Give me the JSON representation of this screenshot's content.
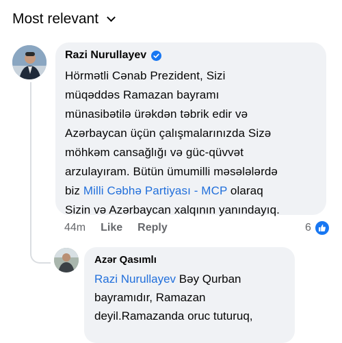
{
  "sort": {
    "label": "Most relevant",
    "icon": "chevron-down-icon"
  },
  "comments": [
    {
      "author": "Razi Nurullayev",
      "verified": true,
      "text_before": "Hörmətli Cənab Prezident, Sizi\nmüqəddəs Ramazan bayramı\nmünasibətilə ürəkdən təbrik edir və\nAzərbaycan üçün çalışmalarınızda Sizə\nmöhkəm cansağlığı və güc-qüvvət\narzulayıram. Bütün ümumilli məsələlərdə\nbiz ",
      "mention": "Milli Cəbhə Partiyası - MCP",
      "text_after": " olaraq\nSizin və Azərbaycan xalqının yanındayıq.",
      "time": "44m",
      "like_label": "Like",
      "reply_label": "Reply",
      "reaction_count": "6",
      "reaction_icon": "like-icon"
    }
  ],
  "replies": [
    {
      "author": "Azər Qasımlı",
      "mention": "Razi Nurullayev",
      "text": " Bəy Qurban\nbayramıdır, Ramazan\ndeyil.Ramazanda oruc tuturuq,"
    }
  ],
  "colors": {
    "mention": "#216fdb",
    "bubble": "#f0f2f5",
    "like_blue": "#1877f2",
    "meta": "#65676b"
  }
}
